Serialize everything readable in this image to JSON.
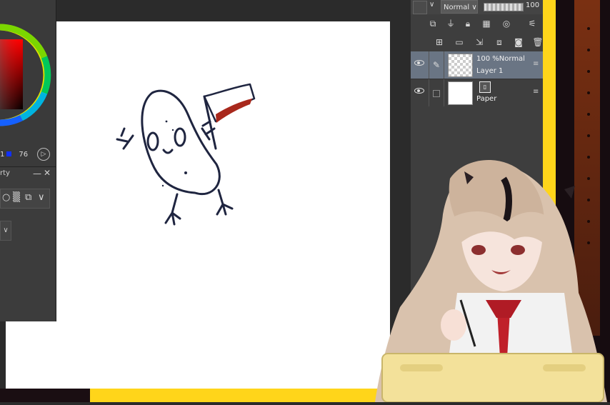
{
  "color_panel": {
    "readout_value_1": "1",
    "readout_value_2": "76"
  },
  "property_panel": {
    "title": "rty",
    "minimize": "—",
    "close": "✕",
    "dropdown_arrow": "∨"
  },
  "layer_panel": {
    "blend_mode": "Normal",
    "opacity": "100",
    "layers": [
      {
        "opacity": "100 %",
        "blend": "Normal",
        "name": "Layer 1"
      },
      {
        "name": "Paper"
      }
    ]
  },
  "icons": {
    "eye": "eye-icon",
    "pen": "pen-icon",
    "lock": "lock-icon",
    "menu": "hamburger-icon"
  },
  "colors": {
    "stream_yellow": "#ffd51a",
    "selected_layer": "#6a7584",
    "panel_dark": "#3e3e3e"
  }
}
